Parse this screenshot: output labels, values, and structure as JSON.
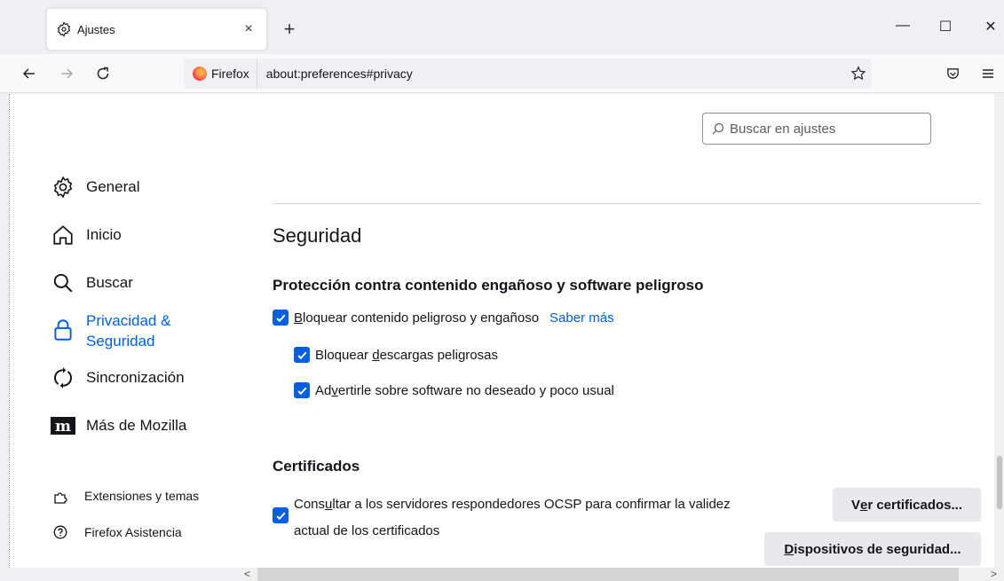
{
  "tab": {
    "title": "Ajustes",
    "close": "×"
  },
  "newtab": "+",
  "window": {
    "minimize": "—",
    "maximize": "☐",
    "close": "✕"
  },
  "url": {
    "identity": "Firefox",
    "address": "about:preferences#privacy"
  },
  "search": {
    "placeholder": "Buscar en ajustes"
  },
  "sidebar": {
    "items": [
      {
        "label": "General",
        "icon": "gear-icon"
      },
      {
        "label": "Inicio",
        "icon": "home-icon"
      },
      {
        "label": "Buscar",
        "icon": "search-icon"
      },
      {
        "label_line1": "Privacidad &",
        "label_line2": "Seguridad",
        "icon": "lock-icon",
        "active": true
      },
      {
        "label": "Sincronización",
        "icon": "sync-icon"
      },
      {
        "label": "Más de Mozilla",
        "icon": "mozilla-icon"
      }
    ],
    "footer": [
      {
        "label": "Extensiones y temas",
        "icon": "puzzle-icon"
      },
      {
        "label": "Firefox Asistencia",
        "icon": "help-icon"
      }
    ]
  },
  "main": {
    "section_title": "Seguridad",
    "protection": {
      "heading": "Protección contra contenido engañoso y software peligroso",
      "block_dangerous": {
        "accesskey": "B",
        "rest": "loquear contenido peligroso y engañoso",
        "checked": true
      },
      "learn_more": "Saber más",
      "block_downloads": {
        "before": "Bloquear ",
        "accesskey": "d",
        "after": "escargas peligrosas",
        "checked": true
      },
      "warn_unwanted": {
        "before": "Ad",
        "accesskey": "v",
        "after": "ertirle sobre software no deseado y poco usual",
        "checked": true
      }
    },
    "certificates": {
      "heading": "Certificados",
      "ocsp": {
        "before": "Cons",
        "accesskey": "u",
        "after": "ltar a los servidores respondedores OCSP para confirmar la validez actual de los certificados",
        "checked": true
      },
      "view_certs": {
        "before": "V",
        "accesskey": "e",
        "after": "r certificados..."
      },
      "security_devices": {
        "before": "",
        "accesskey": "D",
        "after": "ispositivos de seguridad..."
      }
    }
  },
  "colors": {
    "accent": "#0061e0",
    "text": "#15141a",
    "button_bg": "#e9e9ed"
  }
}
